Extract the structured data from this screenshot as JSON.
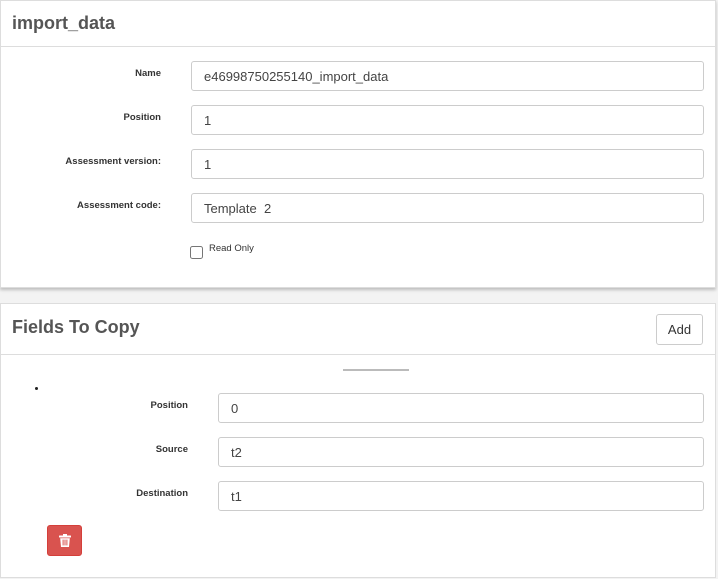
{
  "import_panel": {
    "title": "import_data",
    "fields": {
      "name": {
        "label": "Name",
        "value": "e46998750255140_import_data"
      },
      "position": {
        "label": "Position",
        "value": "1"
      },
      "assessment_version": {
        "label": "Assessment version:",
        "value": "1"
      },
      "assessment_code": {
        "label": "Assessment code:",
        "value": "Template  2"
      }
    },
    "read_only": {
      "label": "Read Only",
      "checked": false
    }
  },
  "fields_panel": {
    "title": "Fields To Copy",
    "add_label": "Add",
    "item": {
      "position": {
        "label": "Position",
        "value": "0"
      },
      "source": {
        "label": "Source",
        "value": "t2"
      },
      "destination": {
        "label": "Destination",
        "value": "t1"
      }
    },
    "delete_icon": "trash-icon",
    "colors": {
      "danger": "#d9534f"
    }
  }
}
